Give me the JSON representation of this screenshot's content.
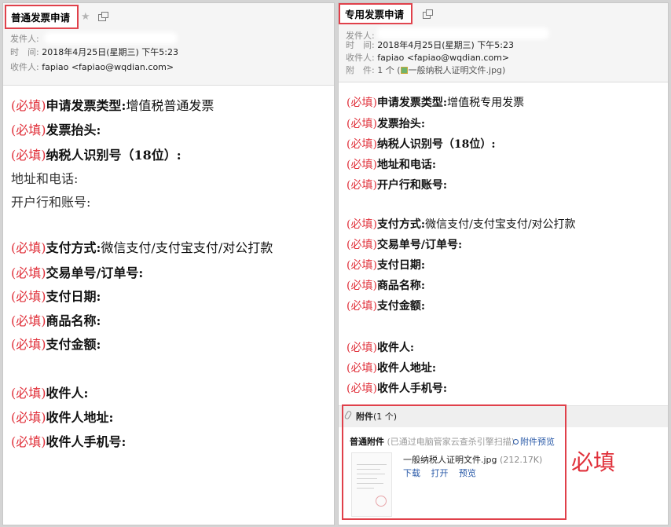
{
  "left": {
    "subject": "普通发票申请",
    "meta": {
      "sender_label": "发件人:",
      "time_label": "时　间:",
      "time_value": "2018年4月25日(星期三) 下午5:23",
      "recipient_label": "收件人:",
      "recipient_value": "fapiao <fapiao@wqdian.com>"
    },
    "lines": [
      {
        "req": "(必填)",
        "label": "申请发票类型:",
        "value": "增值税普通发票"
      },
      {
        "req": "(必填)",
        "label": "发票抬头:",
        "value": ""
      },
      {
        "req": "(必填)",
        "label": "纳税人识别号（18位）:",
        "value": ""
      },
      {
        "req": "",
        "label": "",
        "value": "地址和电话:"
      },
      {
        "req": "",
        "label": "",
        "value": "开户行和账号:"
      },
      {
        "req": "(必填)",
        "label": "支付方式:",
        "value": "微信支付/支付宝支付/对公打款"
      },
      {
        "req": "(必填)",
        "label": "交易单号/订单号:",
        "value": ""
      },
      {
        "req": "(必填)",
        "label": "支付日期:",
        "value": ""
      },
      {
        "req": "(必填)",
        "label": "商品名称:",
        "value": ""
      },
      {
        "req": "(必填)",
        "label": "支付金额:",
        "value": ""
      },
      {
        "req": "(必填)",
        "label": "收件人:",
        "value": ""
      },
      {
        "req": "(必填)",
        "label": "收件人地址:",
        "value": ""
      },
      {
        "req": "(必填)",
        "label": "收件人手机号:",
        "value": ""
      }
    ]
  },
  "right": {
    "subject": "专用发票申请",
    "meta": {
      "sender_label": "发件人:",
      "time_label": "时　间:",
      "time_value": "2018年4月25日(星期三) 下午5:23",
      "recipient_label": "收件人:",
      "recipient_value": "fapiao <fapiao@wqdian.com>",
      "attach_label": "附　件:",
      "attach_value_prefix": "1 个 (",
      "attach_value_file": "一般纳税人证明文件.jpg",
      "attach_value_suffix": ")"
    },
    "lines": [
      {
        "req": "(必填)",
        "label": "申请发票类型:",
        "value": "增值税专用发票"
      },
      {
        "req": "(必填)",
        "label": "发票抬头:",
        "value": ""
      },
      {
        "req": "(必填)",
        "label": "纳税人识别号（18位）:",
        "value": ""
      },
      {
        "req": "(必填)",
        "label": "地址和电话:",
        "value": ""
      },
      {
        "req": "(必填)",
        "label": "开户行和账号:",
        "value": ""
      },
      {
        "req": "(必填)",
        "label": "支付方式:",
        "value": "微信支付/支付宝支付/对公打款"
      },
      {
        "req": "(必填)",
        "label": "交易单号/订单号:",
        "value": ""
      },
      {
        "req": "(必填)",
        "label": "支付日期:",
        "value": ""
      },
      {
        "req": "(必填)",
        "label": "商品名称:",
        "value": ""
      },
      {
        "req": "(必填)",
        "label": "支付金额:",
        "value": ""
      },
      {
        "req": "(必填)",
        "label": "收件人:",
        "value": ""
      },
      {
        "req": "(必填)",
        "label": "收件人地址:",
        "value": ""
      },
      {
        "req": "(必填)",
        "label": "收件人手机号:",
        "value": ""
      }
    ],
    "attachments": {
      "title": "附件",
      "count": "(1 个)",
      "section_label": "普通附件",
      "scan_note": "(已通过电脑管家云查杀引擎扫描)",
      "preview_label": "附件预览",
      "file_name": "一般纳税人证明文件.jpg",
      "file_size": "(212.17K)",
      "actions": [
        "下载",
        "打开",
        "预览"
      ]
    },
    "annotation": "必填"
  },
  "colors": {
    "required_red": "#e0303a",
    "link_blue": "#2a5aa8",
    "highlight_border": "#e0404a"
  },
  "icons": [
    "star-icon",
    "popout-icon",
    "paperclip-icon",
    "magnifier-icon",
    "jpg-file-icon"
  ]
}
